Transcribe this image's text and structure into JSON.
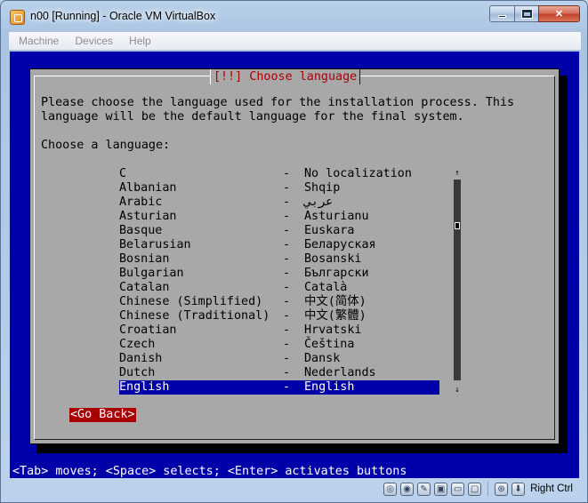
{
  "window": {
    "title": "n00 [Running] - Oracle VM VirtualBox"
  },
  "menubar": {
    "items": [
      {
        "label": "Machine"
      },
      {
        "label": "Devices"
      },
      {
        "label": "Help"
      }
    ]
  },
  "installer": {
    "dialog_title": "[!!] Choose language",
    "intro_text": "Please choose the language used for the installation process. This\nlanguage will be the default language for the final system.",
    "prompt": "Choose a language:",
    "languages": [
      {
        "name": "C",
        "native": "No localization"
      },
      {
        "name": "Albanian",
        "native": "Shqip"
      },
      {
        "name": "Arabic",
        "native": "عربي"
      },
      {
        "name": "Asturian",
        "native": "Asturianu"
      },
      {
        "name": "Basque",
        "native": "Euskara"
      },
      {
        "name": "Belarusian",
        "native": "Беларуская"
      },
      {
        "name": "Bosnian",
        "native": "Bosanski"
      },
      {
        "name": "Bulgarian",
        "native": "Български"
      },
      {
        "name": "Catalan",
        "native": "Català"
      },
      {
        "name": "Chinese (Simplified)",
        "native": "中文(简体)"
      },
      {
        "name": "Chinese (Traditional)",
        "native": "中文(繁體)"
      },
      {
        "name": "Croatian",
        "native": "Hrvatski"
      },
      {
        "name": "Czech",
        "native": "Čeština"
      },
      {
        "name": "Danish",
        "native": "Dansk"
      },
      {
        "name": "Dutch",
        "native": "Nederlands"
      },
      {
        "name": "English",
        "native": "English"
      }
    ],
    "selected_language": "English",
    "dash": "-",
    "go_back_label": "<Go Back>",
    "help_line": "<Tab> moves; <Space> selects; <Enter> activates buttons"
  },
  "statusbar": {
    "host_key_label": "Right Ctrl",
    "icons": [
      "hard-disk-icon",
      "optical-drive-icon",
      "usb-icon",
      "shared-folders-icon",
      "display-icon",
      "video-capture-icon",
      "network-icon",
      "mouse-integration-icon"
    ]
  },
  "colors": {
    "vm_background": "#0000a8",
    "dialog_background": "#a8a8a8",
    "title_red": "#a80000",
    "selection_blue": "#0000a8"
  }
}
